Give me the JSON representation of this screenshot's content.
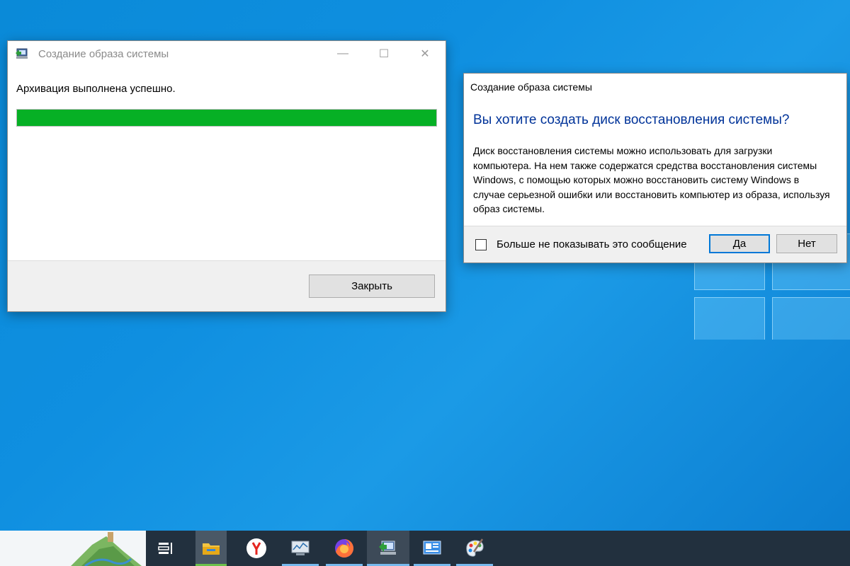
{
  "window_progress": {
    "title": "Создание образа системы",
    "minimize_glyph": "—",
    "maximize_glyph": "☐",
    "close_glyph": "✕",
    "status_text": "Архивация выполнена успешно.",
    "progress_fraction": 1.0,
    "progress_color": "#06b025",
    "close_button_label": "Закрыть"
  },
  "dialog": {
    "title": "Создание образа системы",
    "heading": "Вы хотите создать диск восстановления системы?",
    "body_text": "Диск восстановления системы можно использовать для загрузки компьютера. На нем также содержатся средства восстановления системы Windows, с помощью которых можно восстановить систему Windows в случае серьезной ошибки или восстановить компьютер из образа, используя образ системы.",
    "checkbox_label": "Больше не показывать это сообщение",
    "checkbox_checked": false,
    "yes_label": "Да",
    "no_label": "Нет",
    "heading_color": "#003399"
  },
  "taskbar": {
    "icons": [
      "task-view-icon",
      "file-explorer-icon",
      "yandex-browser-icon",
      "resource-monitor-icon",
      "firefox-icon",
      "system-image-backup-icon",
      "control-panel-icon",
      "paint-icon"
    ],
    "background_color": "#22303e"
  },
  "desktop": {
    "background_color": "#0f8fe0"
  }
}
